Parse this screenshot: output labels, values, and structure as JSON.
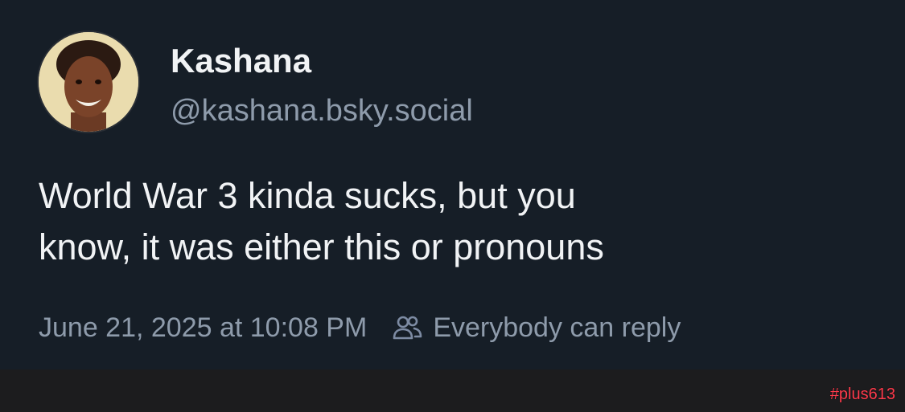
{
  "author": {
    "display_name": "Kashana",
    "handle": "@kashana.bsky.social",
    "avatar_icon": "user-avatar-photo"
  },
  "post": {
    "text_lines": [
      "World War 3 kinda sucks, but you",
      "know, it was either this or pronouns"
    ],
    "timestamp": "June 21, 2025 at 10:08 PM",
    "reply_setting": "Everybody can reply",
    "reply_icon": "people-icon"
  },
  "watermark": "#plus613",
  "colors": {
    "background": "#161e27",
    "text_primary": "#f1f3f5",
    "text_secondary": "#8e9bab",
    "watermark": "#ff3b4c"
  }
}
